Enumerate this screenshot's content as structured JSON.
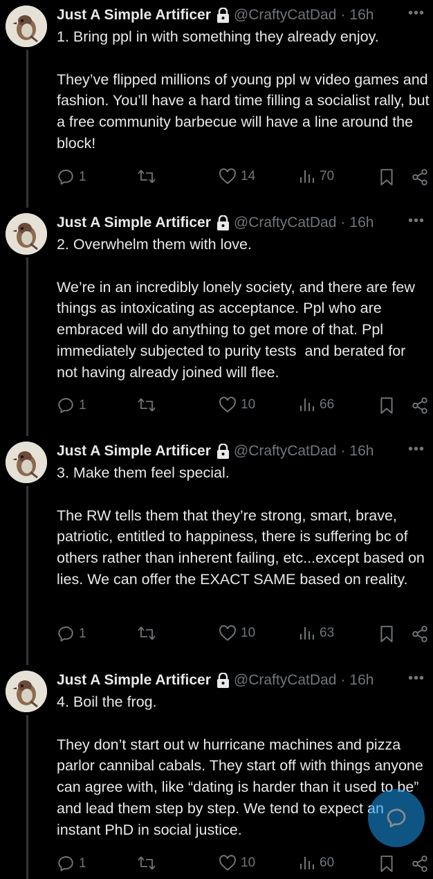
{
  "author": {
    "name": "Just A Simple Artificer",
    "handle": "@CraftyCatDad",
    "time": "16h"
  },
  "icons": {
    "lock": "lock-icon",
    "more": "more-icon",
    "reply": "reply-icon",
    "retweet": "retweet-icon",
    "like": "heart-icon",
    "views": "views-icon",
    "bookmark": "bookmark-icon",
    "share": "share-icon",
    "compose": "compose-icon"
  },
  "more_glyph": "•••",
  "tweets": [
    {
      "text": "1. Bring ppl in with something they already enjoy.\n\nThey’ve flipped millions of young ppl w video games and fashion. You’ll have a hard time filling a socialist rally, but a free community barbecue will have a line around the block!",
      "replies": "1",
      "likes": "14",
      "views": "70"
    },
    {
      "text": "2. Overwhelm them with love.\n\nWe’re in an incredibly lonely society, and there are few things as intoxicating as acceptance. Ppl who are embraced will do anything to get more of that. Ppl immediately subjected to purity tests  and berated for not having already joined will flee.",
      "replies": "1",
      "likes": "10",
      "views": "66"
    },
    {
      "text": "3. Make them feel special.\n\nThe RW tells them that they’re strong, smart, brave, patriotic, entitled to happiness, there is suffering bc of others rather than inherent failing, etc...except based on lies. We can offer the EXACT SAME based on reality.",
      "replies": "1",
      "likes": "10",
      "views": "63"
    },
    {
      "text": "4. Boil the frog.\n\nThey don’t start out w hurricane machines and pizza parlor cannibal cabals. They start off with things anyone can agree with, like “dating is harder than it used to be” and lead them step by step. We tend to expect an instant PhD in social justice.",
      "replies": "1",
      "likes": "10",
      "views": "60"
    }
  ],
  "colors": {
    "background": "#000000",
    "text": "#e7e9ea",
    "secondary": "#71767b",
    "accent": "#1d9bf0"
  }
}
